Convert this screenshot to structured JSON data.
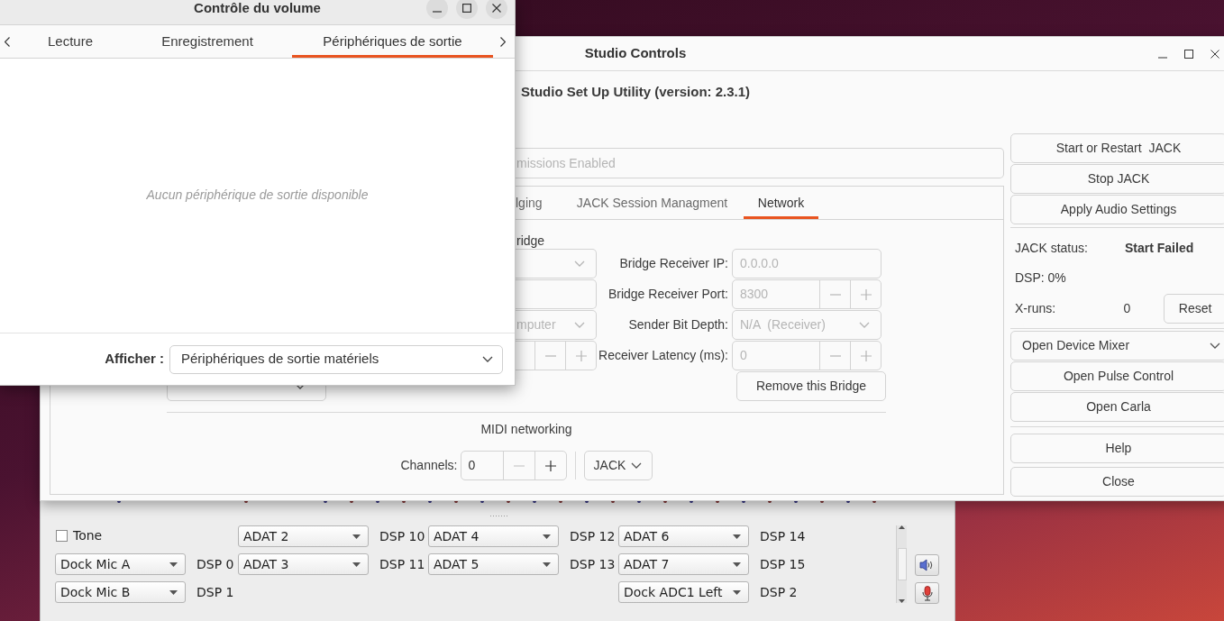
{
  "volume_window": {
    "title": "Contrôle du volume",
    "tabs": [
      {
        "label": "Lecture",
        "selected": false
      },
      {
        "label": "Enregistrement",
        "selected": false
      },
      {
        "label": "Périphériques de sortie",
        "selected": true
      }
    ],
    "message": "Aucun périphérique de sortie disponible",
    "filter": {
      "label": "Afficher :",
      "value": "Périphériques de sortie matériels"
    }
  },
  "studio_window": {
    "title": "Studio Controls",
    "heading": "Studio Set Up Utility (version: 2.3.1)",
    "status_field": "missions Enabled",
    "tabs": [
      {
        "label": "lging",
        "selected": false
      },
      {
        "label": "JACK Session Managment",
        "selected": false
      },
      {
        "label": "Network",
        "selected": true
      }
    ],
    "network": {
      "section_label": "ridge",
      "left_controls": [
        {
          "kind": "dropdown",
          "disabled": true
        },
        {
          "kind": "field"
        },
        {
          "kind": "dropdown",
          "value": "mputer",
          "disabled": true
        },
        {
          "kind": "spinner",
          "disabled": true
        }
      ],
      "bridge_fields": [
        {
          "label": "Bridge Receiver IP:",
          "kind": "field",
          "value": "0.0.0.0",
          "disabled": true
        },
        {
          "label": "Bridge Receiver Port:",
          "kind": "spinner",
          "value": "8300",
          "disabled": true
        },
        {
          "label": "Sender Bit Depth:",
          "kind": "dropdown",
          "value": "N/A  (Receiver)",
          "disabled": true
        },
        {
          "label": "Receiver Latency (ms):",
          "kind": "spinner",
          "value": "0",
          "disabled": true
        }
      ],
      "remove_button": "Remove this Bridge",
      "midi": {
        "heading": "MIDI networking",
        "channels_label": "Channels:",
        "channels_value": "0",
        "backend": "JACK"
      }
    },
    "side_panel": {
      "jack_buttons": [
        "Start or Restart  JACK",
        "Stop JACK",
        "Apply Audio Settings"
      ],
      "status": {
        "label": "JACK status:",
        "value": "Start Failed"
      },
      "dsp": "DSP: 0%",
      "xruns": {
        "label": "X-runs:",
        "value": "0",
        "button": "Reset"
      },
      "tool_menu": "Open Device Mixer",
      "tool_buttons": [
        "Open Pulse Control",
        "Open Carla"
      ],
      "help": "Help",
      "close": "Close"
    }
  },
  "mixer_window": {
    "rows": [
      [
        {
          "kind": "checkbox",
          "label": "Tone",
          "checked": false
        },
        {
          "kind": "empty"
        },
        {
          "kind": "combo",
          "value": "ADAT 2"
        },
        {
          "kind": "label",
          "text": "DSP 10"
        },
        {
          "kind": "combo",
          "value": "ADAT 4"
        },
        {
          "kind": "label",
          "text": "DSP 12"
        },
        {
          "kind": "combo",
          "value": "ADAT 6"
        },
        {
          "kind": "label",
          "text": "DSP 14"
        }
      ],
      [
        {
          "kind": "combo",
          "value": "Dock Mic A"
        },
        {
          "kind": "label",
          "text": "DSP 0"
        },
        {
          "kind": "combo",
          "value": "ADAT 3"
        },
        {
          "kind": "label",
          "text": "DSP 11"
        },
        {
          "kind": "combo",
          "value": "ADAT 5"
        },
        {
          "kind": "label",
          "text": "DSP 13"
        },
        {
          "kind": "combo",
          "value": "ADAT 7"
        },
        {
          "kind": "label",
          "text": "DSP 15"
        }
      ],
      [
        {
          "kind": "combo",
          "value": "Dock Mic B"
        },
        {
          "kind": "label",
          "text": "DSP 1"
        },
        {
          "kind": "empty"
        },
        {
          "kind": "empty"
        },
        {
          "kind": "empty"
        },
        {
          "kind": "empty"
        },
        {
          "kind": "combo",
          "value": "Dock ADC1 Left"
        },
        {
          "kind": "label",
          "text": "DSP 2"
        }
      ]
    ]
  }
}
